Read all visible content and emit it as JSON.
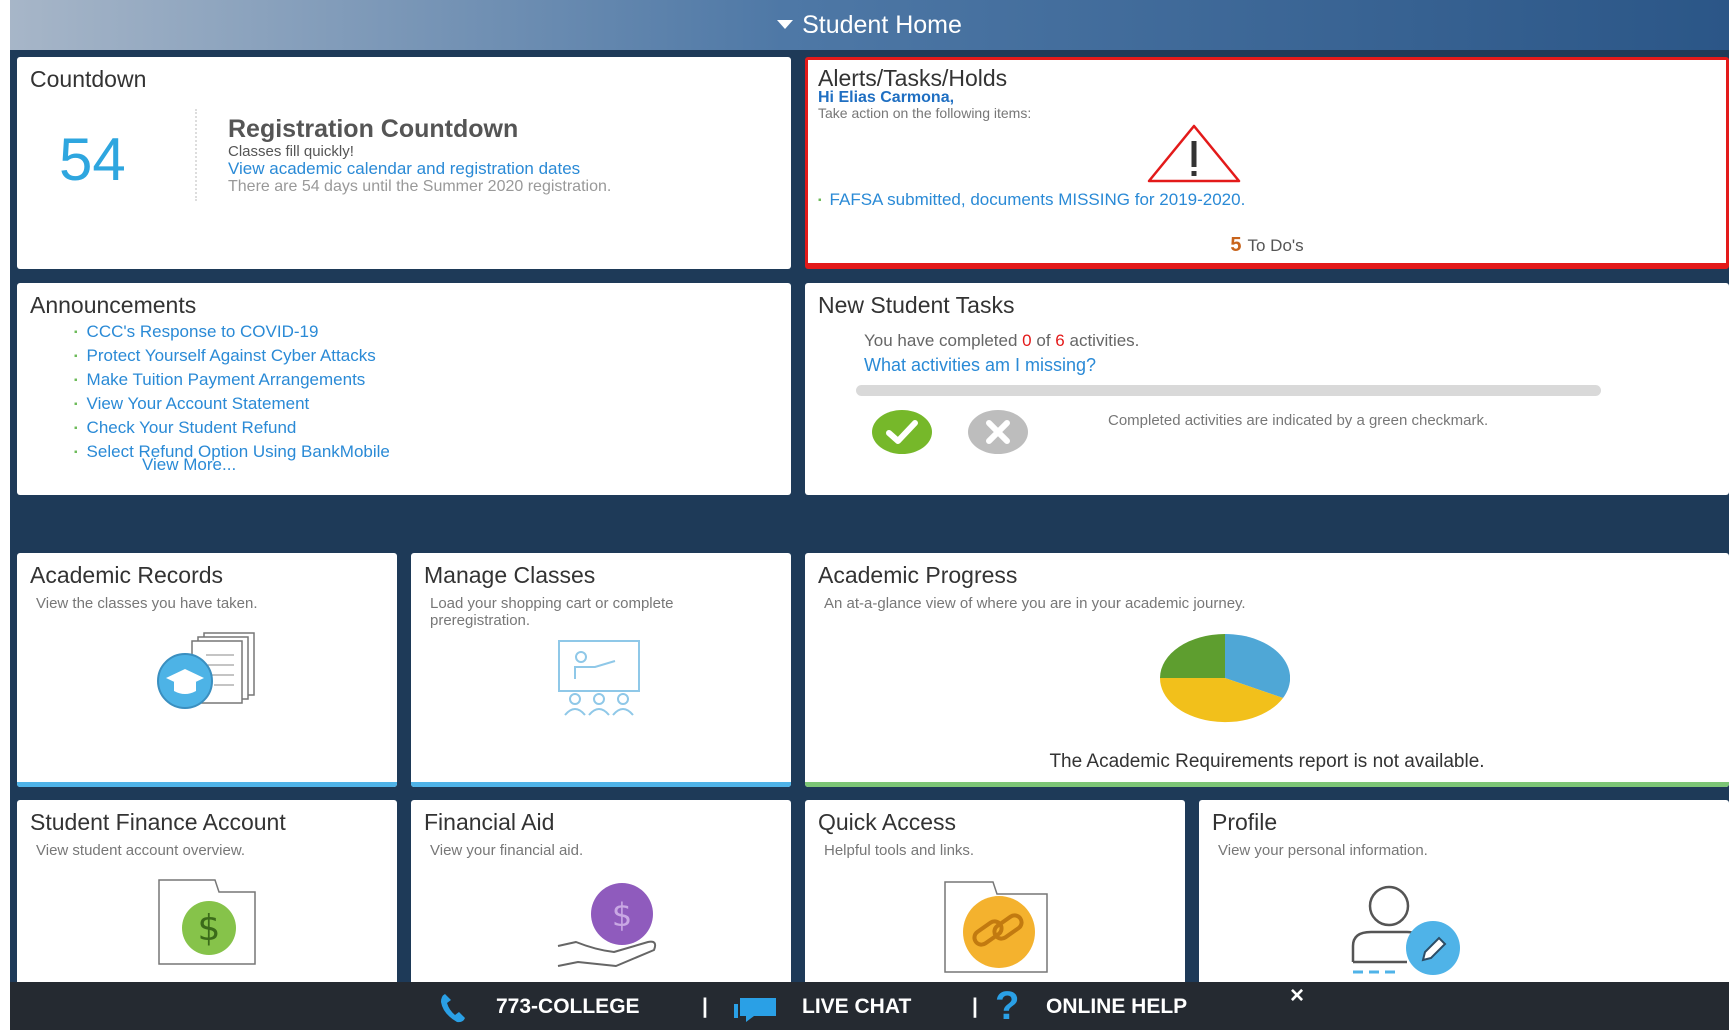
{
  "header": {
    "title": "Student Home"
  },
  "countdown": {
    "title": "Countdown",
    "number": "54",
    "heading": "Registration Countdown",
    "subtitle": "Classes fill quickly!",
    "link": "View academic calendar and registration dates",
    "note": "There are 54 days until the Summer 2020 registration."
  },
  "alerts": {
    "title": "Alerts/Tasks/Holds",
    "greeting": "Hi Elias Carmona,",
    "instruction": "Take action on the following items:",
    "item": "FAFSA submitted, documents MISSING for 2019-2020.",
    "todo_count": "5",
    "todo_label": "To Do's"
  },
  "announcements": {
    "title": "Announcements",
    "items": [
      "CCC's Response to COVID-19",
      "Protect Yourself Against Cyber Attacks",
      "Make Tuition Payment Arrangements",
      "View Your Account Statement",
      "Check Your Student Refund",
      "Select Refund Option Using BankMobile"
    ],
    "more": "View More..."
  },
  "new_student_tasks": {
    "title": "New Student Tasks",
    "text_pre": "You have completed",
    "completed": "0",
    "text_mid": "of",
    "total": "6",
    "text_post": "activities.",
    "progress_fraction": 0,
    "link": "What activities am I missing?",
    "legend": "Completed activities are indicated by a green checkmark."
  },
  "tiles": {
    "academic_records": {
      "title": "Academic Records",
      "desc": "View the classes you have taken."
    },
    "manage_classes": {
      "title": "Manage Classes",
      "desc": "Load your shopping cart or complete preregistration."
    },
    "academic_progress": {
      "title": "Academic Progress",
      "desc": "An at-a-glance view of where you are in your academic journey.",
      "note": "The Academic Requirements report is not available."
    },
    "student_finance": {
      "title": "Student Finance Account",
      "desc": "View student account overview."
    },
    "financial_aid": {
      "title": "Financial Aid",
      "desc": "View your financial aid."
    },
    "quick_access": {
      "title": "Quick Access",
      "desc": "Helpful tools and links."
    },
    "profile": {
      "title": "Profile",
      "desc": "View your personal information."
    }
  },
  "footer": {
    "phone": "773-COLLEGE",
    "chat": "LIVE CHAT",
    "help": "ONLINE HELP",
    "separator": "|"
  },
  "colors": {
    "header_gradient": [
      "#a7b6c8",
      "#2b5687"
    ],
    "background": "#1e3a58",
    "link": "#2a8ad6",
    "alert_border": "#e31a1a",
    "tile_accent_blue": "#4fb3e8",
    "tile_accent_green": "#7cc576",
    "footer": "#252a31"
  },
  "icons": {
    "header_caret": "caret-down-icon",
    "alert": "warning-triangle-icon",
    "complete": "green-checkmark-icon",
    "incomplete": "gray-x-icon",
    "records": "documents-graduation-cap-icon",
    "classes": "presentation-board-icon",
    "progress": "pie-chart-icon",
    "finance": "dollar-folder-icon",
    "aid": "hand-coin-icon",
    "quick": "folder-link-icon",
    "profile": "user-edit-icon",
    "phone": "phone-icon",
    "chat": "chat-bubbles-icon",
    "help": "question-mark-icon",
    "close": "close-icon"
  }
}
